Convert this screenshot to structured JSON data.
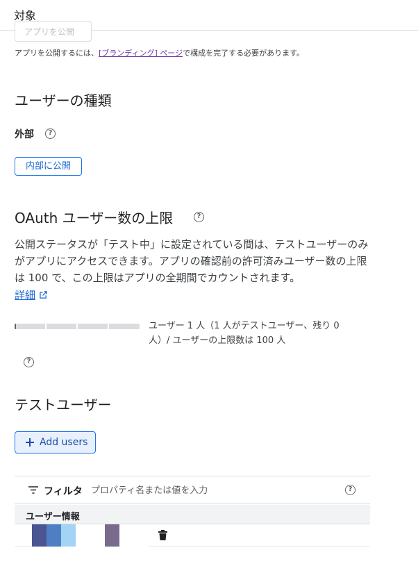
{
  "header": {
    "title": "対象"
  },
  "publishing": {
    "publish_button_label": "アプリを公開",
    "note_prefix": "アプリを公開するには、",
    "note_link": "[ブランディング] ページ",
    "note_suffix": "で構成を完了する必要があります。"
  },
  "user_type": {
    "title": "ユーザーの種類",
    "value": "外部",
    "make_internal_label": "内部に公開"
  },
  "oauth_limit": {
    "title": "OAuth ユーザー数の上限",
    "description": "公開ステータスが「テスト中」に設定されている間は、テストユーザーのみがアプリにアクセスできます。アプリの確認前の許可済みユーザー数の上限は 100 で、この上限はアプリの全期間でカウントされます。",
    "details_link": "詳細",
    "quota_text": "ユーザー 1 人（1 人がテストユーザー、残り 0 人）/ ユーザーの上限数は 100 人",
    "quota_used": 1,
    "quota_max": 100
  },
  "test_users": {
    "title": "テストユーザー",
    "add_button_label": "Add users",
    "filter_label": "フィルタ",
    "filter_placeholder": "プロパティ名または値を入力",
    "columns": [
      "ユーザー情報"
    ],
    "rows": [
      {
        "email_redacted": true
      }
    ]
  },
  "icons": {
    "help": "help-circle-icon",
    "external": "open-in-new-icon",
    "plus": "plus-icon",
    "filter": "filter-list-icon",
    "delete": "trash-icon"
  },
  "colors": {
    "accent": "#1a73e8",
    "accent_text": "#1967d2",
    "link_visited": "#6e3fa1",
    "add_button_bg": "#e8f0fe"
  }
}
